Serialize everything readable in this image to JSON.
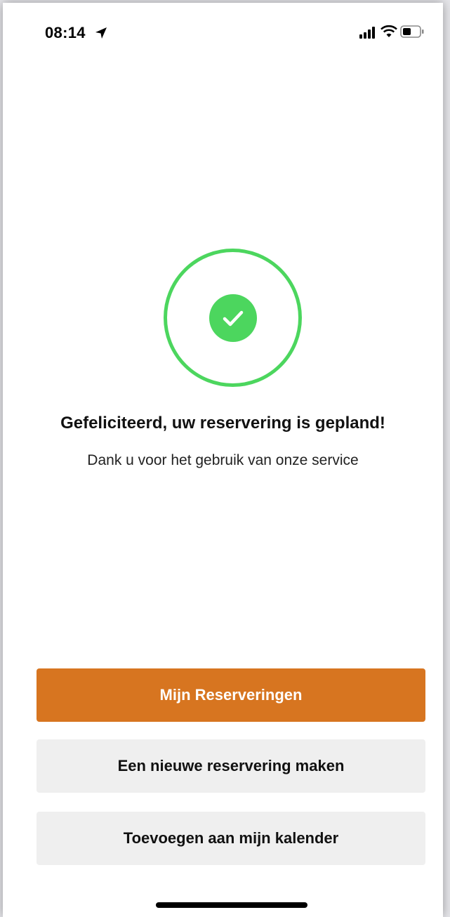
{
  "status_bar": {
    "time": "08:14",
    "icons": [
      "location-arrow-icon",
      "cellular-signal-icon",
      "wifi-icon",
      "battery-icon"
    ]
  },
  "success": {
    "icon": "checkmark-circle-icon",
    "color": "#4cd65e",
    "title": "Gefeliciteerd, uw reservering is gepland!",
    "subtitle": "Dank u voor het gebruik van onze service"
  },
  "actions": {
    "my_reservations": "Mijn Reserveringen",
    "new_reservation": "Een nieuwe reservering maken",
    "add_to_calendar": "Toevoegen aan mijn kalender"
  },
  "colors": {
    "accent": "#d77520",
    "secondary_button": "#efefef"
  }
}
